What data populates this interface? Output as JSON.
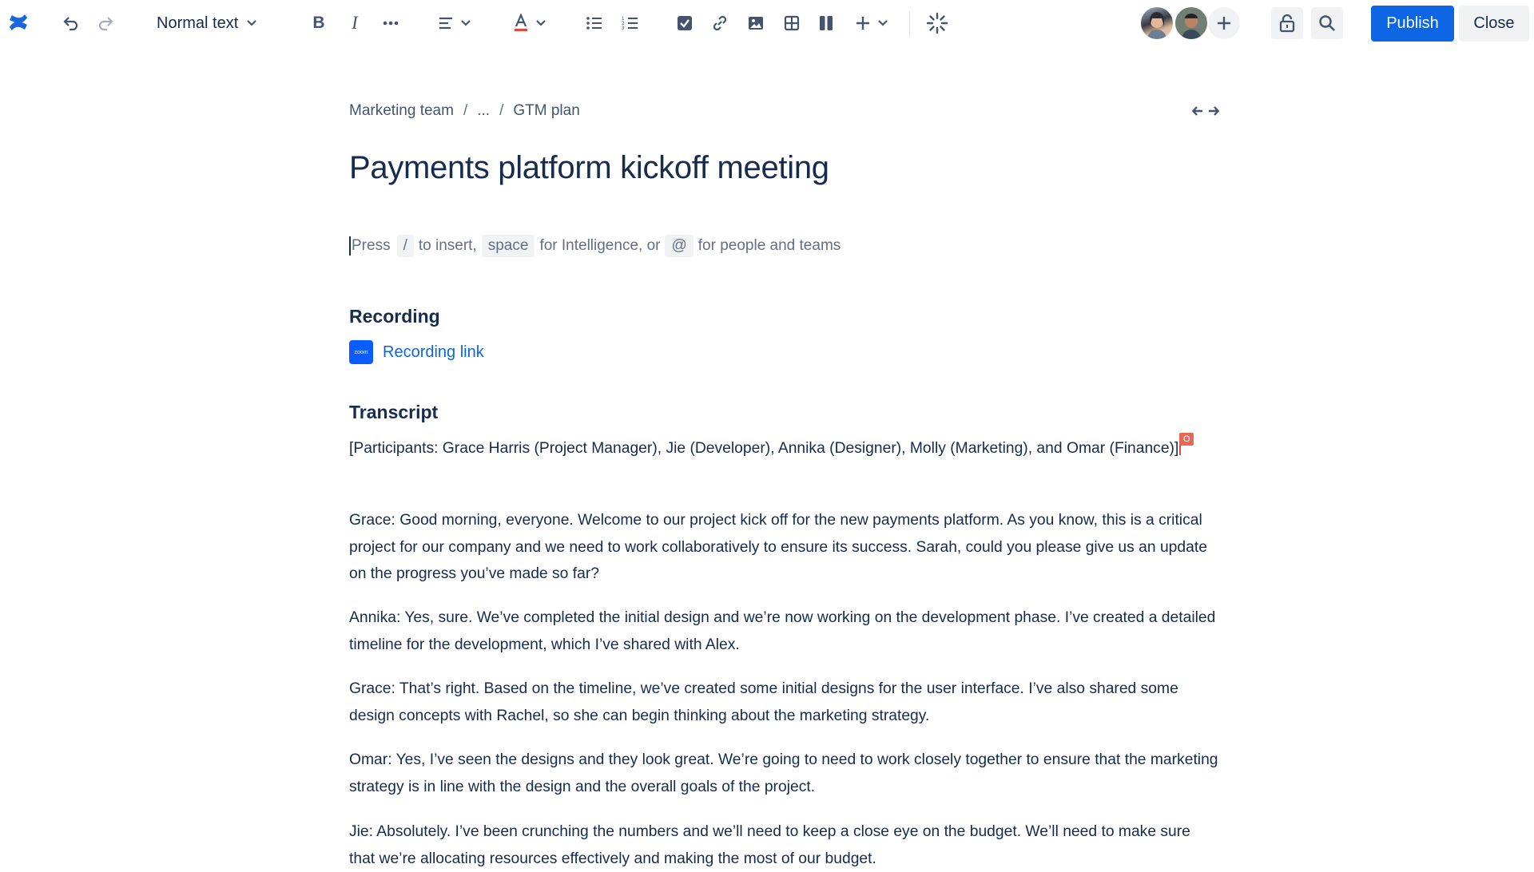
{
  "toolbar": {
    "text_style": "Normal text",
    "icons": [
      "confluence-logo",
      "undo",
      "redo",
      "bold",
      "italic",
      "more-formatting",
      "align",
      "text-color",
      "bullet-list",
      "numbered-list",
      "action-item",
      "link",
      "image",
      "table",
      "layouts",
      "insert",
      "ai"
    ],
    "publish_label": "Publish",
    "close_label": "Close",
    "collaborators": [
      "collaborator-1",
      "collaborator-2"
    ]
  },
  "colors": {
    "primary": "#0c66e4",
    "text": "#172b4d",
    "subtle": "#626f86",
    "confluence": "#1868db",
    "zoom": "#0b5cff",
    "cursor_flag": "#e56955"
  },
  "breadcrumb": {
    "items": [
      "Marketing team",
      "...",
      "GTM plan"
    ],
    "separator": "/"
  },
  "page": {
    "title": "Payments platform kickoff meeting"
  },
  "placeholder": {
    "press": "Press",
    "key_slash": "/",
    "to_insert": "to insert,",
    "key_space": "space",
    "for_intelligence": "for Intelligence, or",
    "key_at": "@",
    "for_people": "for people and teams"
  },
  "recording": {
    "heading": "Recording",
    "zoom_label": "zoom",
    "link_text": "Recording link"
  },
  "transcript": {
    "heading": "Transcript",
    "collaborator_initial": "O",
    "paragraphs": [
      "[Participants: Grace Harris (Project Manager), Jie (Developer),  Annika (Designer), Molly (Marketing), and  Omar (Finance)]",
      "Grace: Good morning, everyone. Welcome to our project kick off for the new payments platform. As you know, this is a critical project for our company and we need to work collaboratively to ensure its success. Sarah, could you please give us an update on the progress you’ve made so far?",
      "Annika: Yes, sure. We’ve completed the initial design and we’re now working on the development phase. I’ve created a detailed timeline for the development, which I’ve shared with Alex.",
      "Grace: That’s right. Based on the timeline, we’ve created some initial designs for the user interface. I’ve also shared some design concepts with Rachel, so she can begin thinking about the marketing strategy.",
      "Omar: Yes, I’ve seen the designs and they look great. We’re going to need to work closely together to ensure that the marketing strategy is in line with the design and the overall goals of the project.",
      "Jie: Absolutely. I’ve been crunching the numbers and we’ll need to keep a close eye on the budget. We’ll need to make sure that we’re allocating resources effectively and making the most of our budget."
    ]
  }
}
